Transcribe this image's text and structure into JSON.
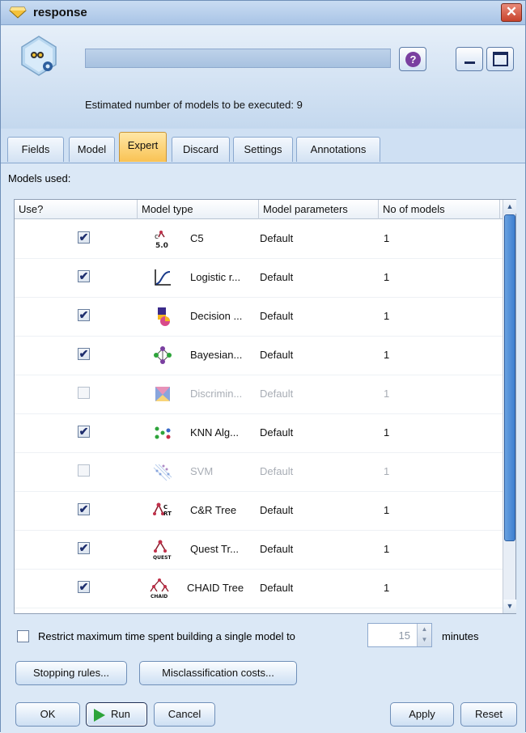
{
  "window": {
    "title": "response",
    "close_glyph": "✕"
  },
  "header": {
    "node_icon": "auto-classifier-node-icon",
    "name_value": "",
    "help_glyph": "?",
    "estimate_text": "Estimated number of models to be executed: 9"
  },
  "tabs": [
    {
      "label": "Fields"
    },
    {
      "label": "Model"
    },
    {
      "label": "Expert",
      "active": true
    },
    {
      "label": "Discard"
    },
    {
      "label": "Settings"
    },
    {
      "label": "Annotations"
    }
  ],
  "models": {
    "section_label": "Models used:",
    "columns": [
      "Use?",
      "Model type",
      "Model parameters",
      "No of models"
    ],
    "rows": [
      {
        "use": true,
        "icon": "c5-icon",
        "name": "C5",
        "params": "Default",
        "count": "1"
      },
      {
        "use": true,
        "icon": "logistic-icon",
        "name": "Logistic r...",
        "params": "Default",
        "count": "1"
      },
      {
        "use": true,
        "icon": "decision-list-icon",
        "name": "Decision ...",
        "params": "Default",
        "count": "1"
      },
      {
        "use": true,
        "icon": "bayesian-icon",
        "name": "Bayesian...",
        "params": "Default",
        "count": "1"
      },
      {
        "use": false,
        "icon": "discriminant-icon",
        "name": "Discrimin...",
        "params": "Default",
        "count": "1"
      },
      {
        "use": true,
        "icon": "knn-icon",
        "name": "KNN Alg...",
        "params": "Default",
        "count": "1"
      },
      {
        "use": false,
        "icon": "svm-icon",
        "name": "SVM",
        "params": "Default",
        "count": "1"
      },
      {
        "use": true,
        "icon": "cart-icon",
        "name": "C&R Tree",
        "params": "Default",
        "count": "1"
      },
      {
        "use": true,
        "icon": "quest-icon",
        "name": "Quest Tr...",
        "params": "Default",
        "count": "1"
      },
      {
        "use": true,
        "icon": "chaid-icon",
        "name": "CHAID Tree",
        "params": "Default",
        "count": "1"
      }
    ],
    "scroll_up_glyph": "▲",
    "scroll_down_glyph": "▼"
  },
  "restrict": {
    "checked": false,
    "label": "Restrict maximum time spent building a single model to",
    "value": "15",
    "unit_label": "minutes"
  },
  "buttons": {
    "stopping": "Stopping rules...",
    "misclassification": "Misclassification costs...",
    "ok": "OK",
    "run": "Run",
    "cancel": "Cancel",
    "apply": "Apply",
    "reset": "Reset"
  },
  "colors": {
    "active_tab": "#f9c253",
    "window_bg": "#d6e6f6",
    "run_play": "#2da43a"
  }
}
